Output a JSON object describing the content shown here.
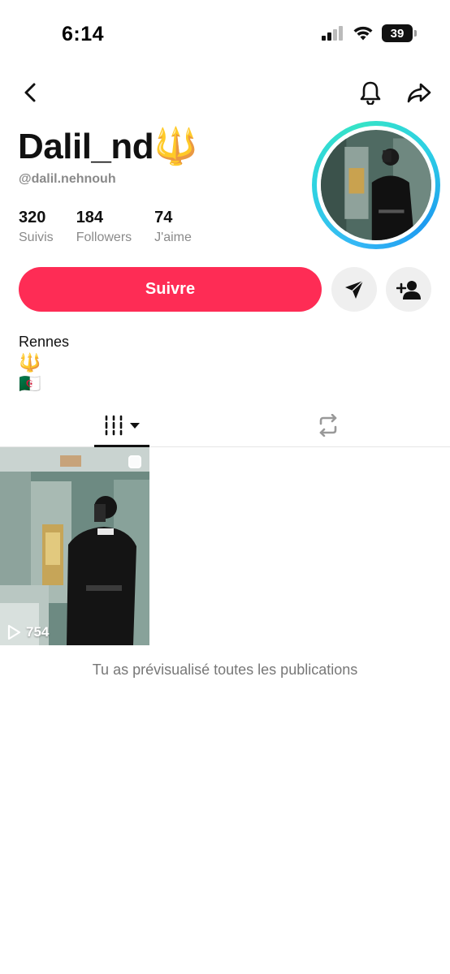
{
  "status": {
    "time": "6:14",
    "battery": "39"
  },
  "profile": {
    "display_name": "Dalil_nd🔱",
    "handle": "@dalil.nehnouh",
    "stats": [
      {
        "value": "320",
        "label": "Suivis"
      },
      {
        "value": "184",
        "label": "Followers"
      },
      {
        "value": "74",
        "label": "J'aime"
      }
    ],
    "follow_label": "Suivre",
    "bio_lines": [
      "Rennes",
      "🔱",
      "🇩🇿"
    ]
  },
  "videos": [
    {
      "views": "754"
    }
  ],
  "footer": {
    "end_message": "Tu as prévisualisé toutes les publications"
  },
  "colors": {
    "accent": "#fe2c55",
    "ring_start": "#1d9bf0",
    "ring_end": "#36e3c6"
  },
  "icons": [
    "back-arrow-icon",
    "bell-icon",
    "share-icon",
    "send-message-icon",
    "add-friend-icon",
    "grid-videos-icon",
    "dropdown-caret-icon",
    "repost-icon",
    "play-icon"
  ]
}
